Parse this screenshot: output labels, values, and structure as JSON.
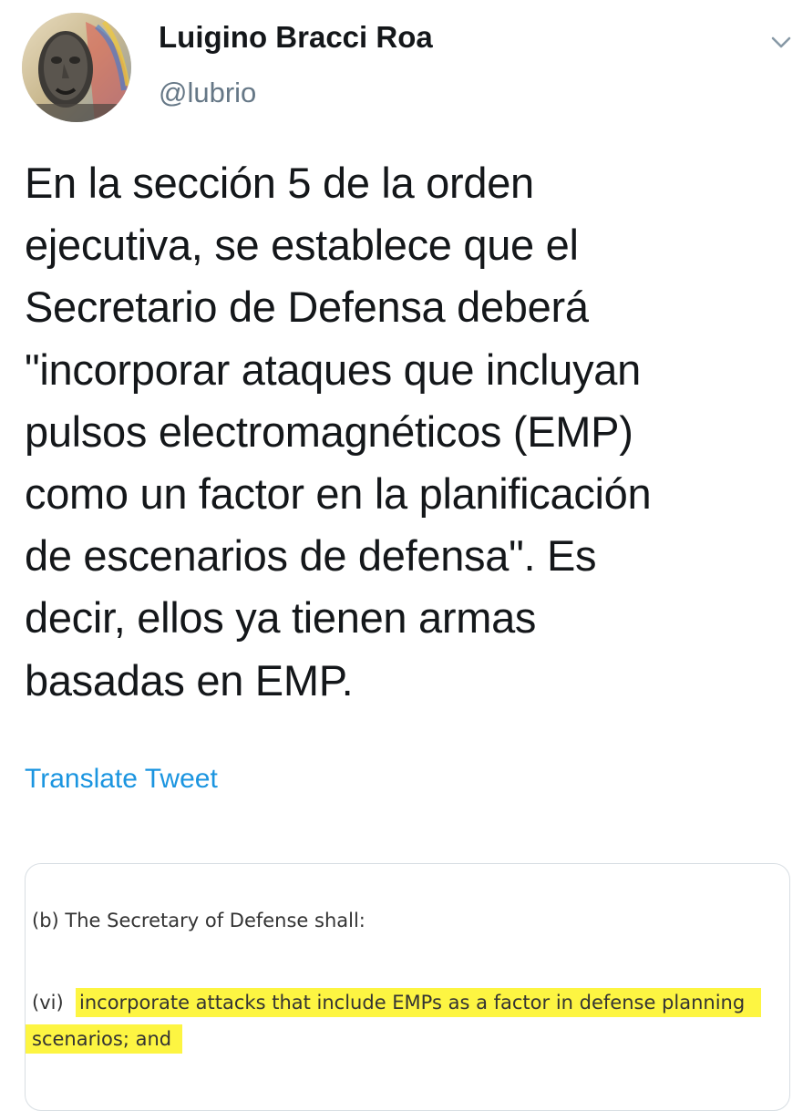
{
  "tweet": {
    "author": {
      "display_name": "Luigino Bracci Roa",
      "handle": "@lubrio",
      "avatar_icon": "profile-avatar"
    },
    "menu_icon": "chevron-down-icon",
    "text": "En la sección 5 de la orden\nejecutiva, se establece que el\nSecretario de Defensa deberá\n\"incorporar ataques que incluyan\npulsos electromagnéticos (EMP)\ncomo un factor en la planificación\nde escenarios de defensa\". Es\ndecir, ellos ya tienen armas\nbasadas en EMP.",
    "translate_label": "Translate Tweet",
    "link_color": "#1b95e0"
  },
  "attached_image": {
    "line_b": "(b)  The Secretary of Defense shall:",
    "line_vi_label": "(vi)",
    "highlight_line_1": "incorporate attacks that include EMPs as a factor in defense planning",
    "highlight_line_2": "scenarios; and",
    "highlight_color": "#fdf542"
  }
}
